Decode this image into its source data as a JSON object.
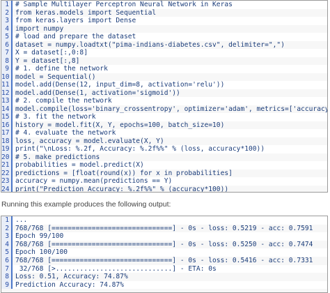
{
  "code_block_1": {
    "lines": [
      {
        "n": "1",
        "text": "# Sample Multilayer Perceptron Neural Network in Keras"
      },
      {
        "n": "2",
        "text": "from keras.models import Sequential"
      },
      {
        "n": "3",
        "text": "from keras.layers import Dense"
      },
      {
        "n": "4",
        "text": "import numpy"
      },
      {
        "n": "5",
        "text": "# load and prepare the dataset"
      },
      {
        "n": "6",
        "text": "dataset = numpy.loadtxt(\"pima-indians-diabetes.csv\", delimiter=\",\")"
      },
      {
        "n": "7",
        "text": "X = dataset[:,0:8]"
      },
      {
        "n": "8",
        "text": "Y = dataset[:,8]"
      },
      {
        "n": "9",
        "text": "# 1. define the network"
      },
      {
        "n": "10",
        "text": "model = Sequential()"
      },
      {
        "n": "11",
        "text": "model.add(Dense(12, input_dim=8, activation='relu'))"
      },
      {
        "n": "12",
        "text": "model.add(Dense(1, activation='sigmoid'))"
      },
      {
        "n": "13",
        "text": "# 2. compile the network"
      },
      {
        "n": "14",
        "text": "model.compile(loss='binary_crossentropy', optimizer='adam', metrics=['accuracy'])"
      },
      {
        "n": "15",
        "text": "# 3. fit the network"
      },
      {
        "n": "16",
        "text": "history = model.fit(X, Y, epochs=100, batch_size=10)"
      },
      {
        "n": "17",
        "text": "# 4. evaluate the network"
      },
      {
        "n": "18",
        "text": "loss, accuracy = model.evaluate(X, Y)"
      },
      {
        "n": "19",
        "text": "print(\"\\nLoss: %.2f, Accuracy: %.2f%%\" % (loss, accuracy*100))"
      },
      {
        "n": "20",
        "text": "# 5. make predictions"
      },
      {
        "n": "21",
        "text": "probabilities = model.predict(X)"
      },
      {
        "n": "22",
        "text": "predictions = [float(round(x)) for x in probabilities]"
      },
      {
        "n": "23",
        "text": "accuracy = numpy.mean(predictions == Y)"
      },
      {
        "n": "24",
        "text": "print(\"Prediction Accuracy: %.2f%%\" % (accuracy*100))"
      }
    ]
  },
  "separator_text": "Running this example produces the following output:",
  "code_block_2": {
    "lines": [
      {
        "n": "1",
        "text": "..."
      },
      {
        "n": "2",
        "text": "768/768 [==============================] - 0s - loss: 0.5219 - acc: 0.7591"
      },
      {
        "n": "3",
        "text": "Epoch 99/100"
      },
      {
        "n": "4",
        "text": "768/768 [==============================] - 0s - loss: 0.5250 - acc: 0.7474"
      },
      {
        "n": "5",
        "text": "Epoch 100/100"
      },
      {
        "n": "6",
        "text": "768/768 [==============================] - 0s - loss: 0.5416 - acc: 0.7331"
      },
      {
        "n": "7",
        "text": " 32/768 [>.............................] - ETA: 0s"
      },
      {
        "n": "8",
        "text": "Loss: 0.51, Accuracy: 74.87%"
      },
      {
        "n": "9",
        "text": "Prediction Accuracy: 74.87%"
      }
    ]
  }
}
